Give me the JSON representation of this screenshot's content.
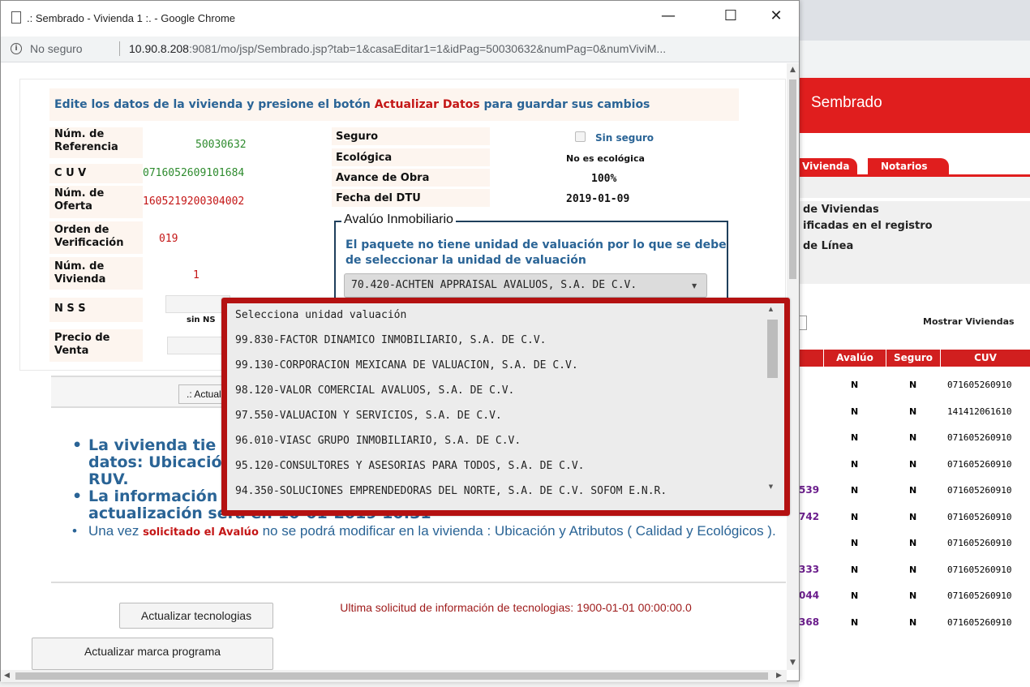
{
  "background": {
    "banner_title": "Sembrado",
    "tabs": [
      "Vivienda",
      "Notarios"
    ],
    "lines": [
      "de Viviendas",
      "ificadas en el registro",
      "de Línea"
    ],
    "mostrar": "Mostrar Viviendas",
    "table_headers": [
      "Avalúo",
      "Seguro",
      "CUV"
    ],
    "rows": [
      {
        "num": "",
        "avaluo": "N",
        "seguro": "N",
        "cuv": "071605260910"
      },
      {
        "num": "",
        "avaluo": "N",
        "seguro": "N",
        "cuv": "141412061610"
      },
      {
        "num": "",
        "avaluo": "N",
        "seguro": "N",
        "cuv": "071605260910"
      },
      {
        "num": "",
        "avaluo": "N",
        "seguro": "N",
        "cuv": "071605260910"
      },
      {
        "num": "539",
        "avaluo": "N",
        "seguro": "N",
        "cuv": "071605260910"
      },
      {
        "num": "742",
        "avaluo": "N",
        "seguro": "N",
        "cuv": "071605260910"
      },
      {
        "num": "",
        "avaluo": "N",
        "seguro": "N",
        "cuv": "071605260910"
      },
      {
        "num": "333",
        "avaluo": "N",
        "seguro": "N",
        "cuv": "071605260910"
      },
      {
        "num": "044",
        "avaluo": "N",
        "seguro": "N",
        "cuv": "071605260910"
      },
      {
        "num": "368",
        "avaluo": "N",
        "seguro": "N",
        "cuv": "071605260910"
      }
    ],
    "accent_color": "#e01e1e"
  },
  "window": {
    "title": ".: Sembrado - Vivienda 1 :. - Google Chrome",
    "minimize": "—",
    "maximize": "☐",
    "close": "✕",
    "info_icon": "i",
    "security": "No seguro",
    "url_host": "10.90.8.208",
    "url_rest": ":9081/mo/jsp/Sembrado.jsp?tab=1&casaEditar1=1&idPag=50030632&numPag=0&numViviM..."
  },
  "form": {
    "instruction_pre": "Edite los datos de la vivienda y presione el botón ",
    "instruction_action": "Actualizar Datos",
    "instruction_post": " para guardar sus cambios",
    "fields": {
      "num_referencia_label": "Núm. de Referencia",
      "num_referencia": "50030632",
      "cuv_label": "C U V",
      "cuv": "0716052609101684",
      "num_oferta_label": "Núm. de Oferta",
      "num_oferta": "1605219200304002",
      "orden_label": "Orden de Verificación",
      "orden": "019",
      "num_vivienda_label": "Núm. de Vivienda",
      "num_vivienda": "1",
      "nss_label": "N S S",
      "sin_nss": "sin NS",
      "precio_label": "Precio de Venta"
    },
    "right": {
      "seguro_label": "Seguro",
      "sin_seguro": "Sin seguro",
      "ecologica_label": "Ecológica",
      "ecologica": "No es ecológica",
      "avance_label": "Avance de Obra",
      "avance": "100%",
      "dtu_label": "Fecha del DTU",
      "dtu": "2019-01-09"
    },
    "avaluo": {
      "legend": "Avalúo Inmobiliario",
      "message": "El paquete no tiene unidad de valuación por lo que se debe de seleccionar la unidad de valuación",
      "selected": "70.420-ACHTEN APPRAISAL AVALUOS, S.A. DE C.V."
    },
    "actualizar_button": ".: Actualizar Datos :."
  },
  "dropdown": {
    "options": [
      "Selecciona unidad valuación",
      "99.830-FACTOR DINAMICO INMOBILIARIO, S.A. DE C.V.",
      "99.130-CORPORACION MEXICANA DE VALUACION, S.A. DE C.V.",
      "98.120-VALOR COMERCIAL AVALUOS, S.A. DE C.V.",
      "97.550-VALUACION Y SERVICIOS, S.A. DE C.V.",
      "96.010-VIASC GRUPO INMOBILIARIO, S.A. DE C.V.",
      "95.120-CONSULTORES Y ASESORIAS PARA TODOS, S.A. DE C.V.",
      "94.350-SOLUCIONES EMPRENDEDORAS DEL NORTE, S.A. DE C.V. SOFOM E.N.R."
    ],
    "highlight_color": "#b41111"
  },
  "notes": {
    "b1_line1": "La vivienda tie",
    "b1_line2": "datos: Ubicació",
    "b1_line3": "RUV.",
    "b2_line1": "La información",
    "b2_line2": "actualización sera el: 10-01-2019 10:31",
    "b3_pre": "Una vez ",
    "b3_red": "solicitado el Avalúo",
    "b3_post": " no se podrá modificar en la vivienda : Ubicación y Atributos ( Calidad y Ecológicos )."
  },
  "tech": {
    "button": "Actualizar tecnologias",
    "status": "Ultima solicitud de información de tecnologias: 1900-01-01 00:00:00.0",
    "marca_button": "Actualizar marca programa"
  }
}
